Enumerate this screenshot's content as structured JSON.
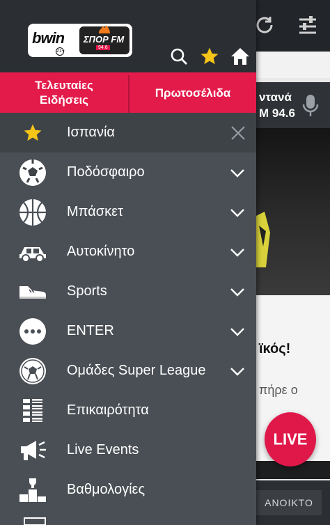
{
  "background_app": {
    "radio_line1": "ντανά",
    "radio_line2": "M 94.6",
    "headline": "ϊκός!",
    "subtext": "πήρε ο",
    "live_button": "LIVE",
    "open_button": "ΑΝΟΙΚΤΟ"
  },
  "drawer": {
    "logo": {
      "brand": "bwin",
      "age_badge": "21+",
      "station": "ΣΠΟΡ FM",
      "frequency": "94.6"
    },
    "header_icons": [
      "search-icon",
      "star-icon",
      "home-icon"
    ],
    "tabs": [
      {
        "label": "Τελευταίες Ειδήσεις"
      },
      {
        "label": "Πρωτοσέλιδα"
      }
    ],
    "favorite": {
      "label": "Ισπανία",
      "icon": "star-icon"
    },
    "items": [
      {
        "label": "Ποδόσφαιρο",
        "icon": "football-icon",
        "has_chevron": true
      },
      {
        "label": "Μπάσκετ",
        "icon": "basketball-icon",
        "has_chevron": true
      },
      {
        "label": "Αυτοκίνητο",
        "icon": "car-icon",
        "has_chevron": true
      },
      {
        "label": "Sports",
        "icon": "sneaker-icon",
        "has_chevron": true
      },
      {
        "label": "ENTER",
        "icon": "more-dots-icon",
        "has_chevron": true
      },
      {
        "label": "Ομάδες Super League",
        "icon": "team-ball-icon",
        "has_chevron": true
      },
      {
        "label": "Επικαιρότητα",
        "icon": "news-list-icon",
        "has_chevron": false
      },
      {
        "label": "Live Events",
        "icon": "megaphone-icon",
        "has_chevron": false
      },
      {
        "label": "Βαθμολογίες",
        "icon": "podium-icon",
        "has_chevron": false
      }
    ]
  },
  "colors": {
    "accent": "#e31b4b",
    "drawer_bg": "#4a4f55",
    "header_bg": "#2b2f33",
    "star": "#f5c518"
  }
}
